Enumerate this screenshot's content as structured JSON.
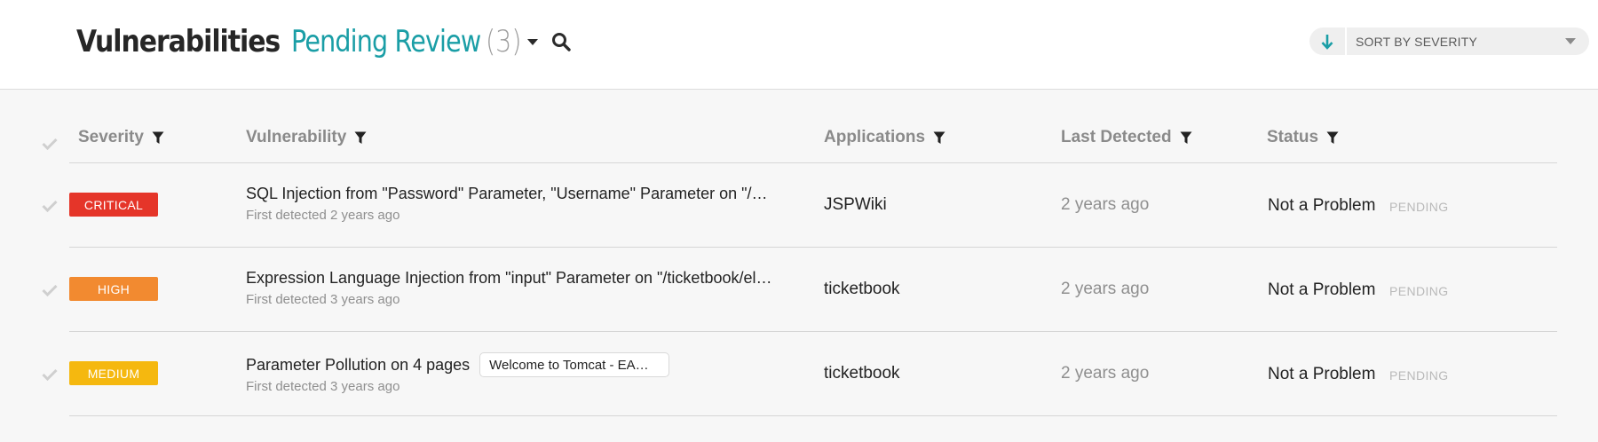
{
  "header": {
    "title": "Vulnerabilities",
    "subtitle": "Pending Review",
    "count": "(3)",
    "sort_label": "SORT BY SEVERITY"
  },
  "columns": {
    "severity": "Severity",
    "vulnerability": "Vulnerability",
    "applications": "Applications",
    "last_detected": "Last Detected",
    "status": "Status"
  },
  "colors": {
    "accent": "#1a9ea6",
    "critical": "#e53529",
    "high": "#f28a30",
    "medium": "#f5b80f"
  },
  "rows": [
    {
      "severity": "CRITICAL",
      "severity_color": "#e53529",
      "title": "SQL Injection from \"Password\" Parameter, \"Username\" Parameter on \"/…",
      "first_detected": "First detected 2 years ago",
      "page_chip": "",
      "application": "JSPWiki",
      "last_detected": "2 years ago",
      "status": "Not a Problem",
      "review": "PENDING"
    },
    {
      "severity": "HIGH",
      "severity_color": "#f28a30",
      "title": "Expression Language Injection from \"input\" Parameter on \"/ticketbook/el…",
      "first_detected": "First detected 3 years ago",
      "page_chip": "",
      "application": "ticketbook",
      "last_detected": "2 years ago",
      "status": "Not a Problem",
      "review": "PENDING"
    },
    {
      "severity": "MEDIUM",
      "severity_color": "#f5b80f",
      "title": "Parameter Pollution on 4 pages",
      "first_detected": "First detected 3 years ago",
      "page_chip": "Welcome to Tomcat - EA…",
      "application": "ticketbook",
      "last_detected": "2 years ago",
      "status": "Not a Problem",
      "review": "PENDING"
    }
  ],
  "icons": {
    "caret": "caret-down-icon",
    "search": "search-icon",
    "sort_direction": "arrow-down-icon",
    "sort_dropdown": "chevron-down-icon",
    "filter": "filter-icon",
    "check": "check-icon"
  }
}
